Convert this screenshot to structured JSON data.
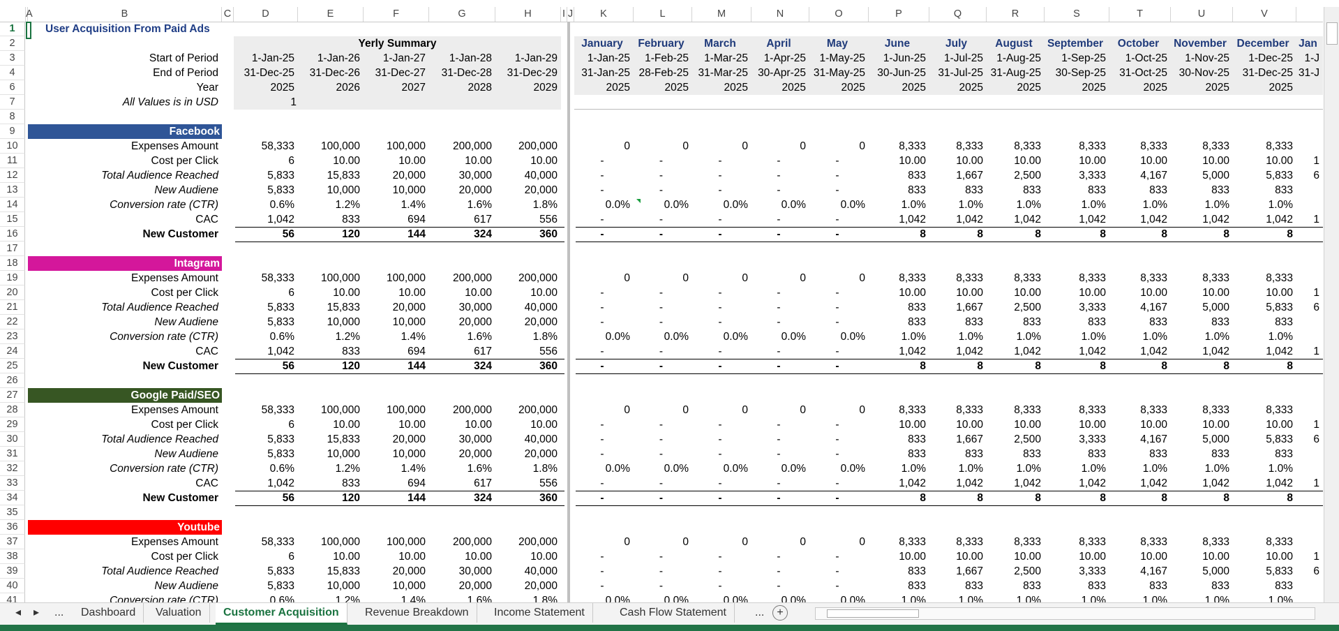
{
  "title": "User Acquisition From Paid Ads",
  "col_headers": [
    "A",
    "B",
    "C",
    "D",
    "E",
    "F",
    "G",
    "H",
    "I",
    "J",
    "K",
    "L",
    "M",
    "N",
    "O",
    "P",
    "Q",
    "R",
    "S",
    "T",
    "U",
    "V"
  ],
  "row_numbers": [
    "1",
    "2",
    "3",
    "4",
    "6",
    "7",
    "8",
    "9",
    "10",
    "11",
    "12",
    "13",
    "14",
    "15",
    "16",
    "17",
    "18",
    "19",
    "20",
    "21",
    "22",
    "23",
    "24",
    "25",
    "26",
    "27",
    "28",
    "29",
    "30",
    "31",
    "32",
    "33",
    "34",
    "35",
    "36",
    "37",
    "38",
    "39",
    "40",
    "41"
  ],
  "header": {
    "yearly_title": "Yerly Summary",
    "start_label": "Start of Period",
    "end_label": "End of Period",
    "year_label": "Year",
    "units_label": "All Values is in USD",
    "units_value": "1",
    "yearly_start": [
      "1-Jan-25",
      "1-Jan-26",
      "1-Jan-27",
      "1-Jan-28",
      "1-Jan-29"
    ],
    "yearly_end": [
      "31-Dec-25",
      "31-Dec-26",
      "31-Dec-27",
      "31-Dec-28",
      "31-Dec-29"
    ],
    "yearly_year": [
      "2025",
      "2026",
      "2027",
      "2028",
      "2029"
    ],
    "months": [
      "January",
      "February",
      "March",
      "April",
      "May",
      "June",
      "July",
      "August",
      "September",
      "October",
      "November",
      "December",
      "Jan"
    ],
    "monthly_start": [
      "1-Jan-25",
      "1-Feb-25",
      "1-Mar-25",
      "1-Apr-25",
      "1-May-25",
      "1-Jun-25",
      "1-Jul-25",
      "1-Aug-25",
      "1-Sep-25",
      "1-Oct-25",
      "1-Nov-25",
      "1-Dec-25",
      "1-J"
    ],
    "monthly_end": [
      "31-Jan-25",
      "28-Feb-25",
      "31-Mar-25",
      "30-Apr-25",
      "31-May-25",
      "30-Jun-25",
      "31-Jul-25",
      "31-Aug-25",
      "30-Sep-25",
      "31-Oct-25",
      "30-Nov-25",
      "31-Dec-25",
      "31-J"
    ],
    "monthly_year": [
      "2025",
      "2025",
      "2025",
      "2025",
      "2025",
      "2025",
      "2025",
      "2025",
      "2025",
      "2025",
      "2025",
      "2025",
      ""
    ]
  },
  "sections": [
    {
      "name": "Facebook",
      "color": "#2f5597"
    },
    {
      "name": "Intagram",
      "color": "#d4179b"
    },
    {
      "name": "Google Paid/SEO",
      "color": "#375623"
    },
    {
      "name": "Youtube",
      "color": "#ff0000"
    }
  ],
  "labels": [
    "Expenses Amount",
    "Cost per Click",
    "Total Audience Reached",
    "New Audiene",
    "Conversion rate (CTR)",
    "CAC",
    "New Customer"
  ],
  "label_italic": [
    false,
    false,
    true,
    true,
    true,
    false,
    false
  ],
  "yearly_rows": [
    [
      "58,333",
      "100,000",
      "100,000",
      "200,000",
      "200,000"
    ],
    [
      "6",
      "10.00",
      "10.00",
      "10.00",
      "10.00"
    ],
    [
      "5,833",
      "15,833",
      "20,000",
      "30,000",
      "40,000"
    ],
    [
      "5,833",
      "10,000",
      "10,000",
      "20,000",
      "20,000"
    ],
    [
      "0.6%",
      "1.2%",
      "1.4%",
      "1.6%",
      "1.8%"
    ],
    [
      "1,042",
      "833",
      "694",
      "617",
      "556"
    ],
    [
      "56",
      "120",
      "144",
      "324",
      "360"
    ]
  ],
  "monthly_rows": [
    [
      "0",
      "0",
      "0",
      "0",
      "0",
      "8,333",
      "8,333",
      "8,333",
      "8,333",
      "8,333",
      "8,333",
      "8,333",
      ""
    ],
    [
      "-",
      "-",
      "-",
      "-",
      "-",
      "10.00",
      "10.00",
      "10.00",
      "10.00",
      "10.00",
      "10.00",
      "10.00",
      "1"
    ],
    [
      "-",
      "-",
      "-",
      "-",
      "-",
      "833",
      "1,667",
      "2,500",
      "3,333",
      "4,167",
      "5,000",
      "5,833",
      "6"
    ],
    [
      "-",
      "-",
      "-",
      "-",
      "-",
      "833",
      "833",
      "833",
      "833",
      "833",
      "833",
      "833",
      ""
    ],
    [
      "0.0%",
      "0.0%",
      "0.0%",
      "0.0%",
      "0.0%",
      "1.0%",
      "1.0%",
      "1.0%",
      "1.0%",
      "1.0%",
      "1.0%",
      "1.0%",
      ""
    ],
    [
      "-",
      "-",
      "-",
      "-",
      "-",
      "1,042",
      "1,042",
      "1,042",
      "1,042",
      "1,042",
      "1,042",
      "1,042",
      "1"
    ],
    [
      "-",
      "-",
      "-",
      "-",
      "-",
      "8",
      "8",
      "8",
      "8",
      "8",
      "8",
      "8",
      ""
    ]
  ],
  "tabs": [
    "Dashboard",
    "Valuation",
    "Customer Acquisition",
    "Revenue Breakdown",
    "Income Statement",
    "Cash Flow Statement"
  ],
  "active_tab": "Customer Acquisition",
  "tab_nav": {
    "prev": "◂",
    "next": "▸",
    "more_left": "...",
    "more_right": "...",
    "add": "+"
  }
}
